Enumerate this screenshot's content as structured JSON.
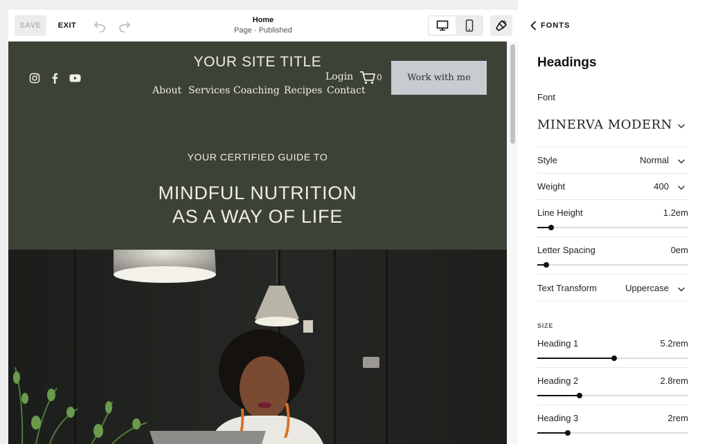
{
  "toolbar": {
    "save_label": "SAVE",
    "exit_label": "EXIT",
    "page_title": "Home",
    "page_status": "Page · Published",
    "undo_icon": "undo-icon",
    "redo_icon": "redo-icon",
    "desktop_icon": "desktop-icon",
    "mobile_icon": "mobile-icon",
    "style_icon": "paintbrush-icon"
  },
  "site": {
    "title": "YOUR SITE TITLE",
    "social": [
      "instagram-icon",
      "facebook-icon",
      "youtube-icon"
    ],
    "nav": [
      "About",
      "Services",
      "Coaching",
      "Recipes",
      "Contact"
    ],
    "login": "Login",
    "cart_count": "0",
    "cta": "Work with me",
    "eyebrow": "YOUR CERTIFIED GUIDE TO",
    "headline_line1": "MINDFUL NUTRITION",
    "headline_line2": "AS A WAY OF LIFE",
    "background_color": "#3d4236",
    "cta_color": "#c8cbcf"
  },
  "panel": {
    "back_label": "FONTS",
    "heading": "Headings",
    "font_label": "Font",
    "font_value": "MINERVA MODERN",
    "style_label": "Style",
    "style_value": "Normal",
    "weight_label": "Weight",
    "weight_value": "400",
    "line_height_label": "Line Height",
    "line_height_value": "1.2em",
    "line_height_level": 0.09,
    "letter_spacing_label": "Letter Spacing",
    "letter_spacing_value": "0em",
    "letter_spacing_level": 0.06,
    "text_transform_label": "Text Transform",
    "text_transform_value": "Uppercase",
    "size_caption": "SIZE",
    "heading1_label": "Heading 1",
    "heading1_value": "5.2rem",
    "heading1_level": 0.51,
    "heading2_label": "Heading 2",
    "heading2_value": "2.8rem",
    "heading2_level": 0.28,
    "heading3_label": "Heading 3",
    "heading3_value": "2rem",
    "heading3_level": 0.2
  }
}
